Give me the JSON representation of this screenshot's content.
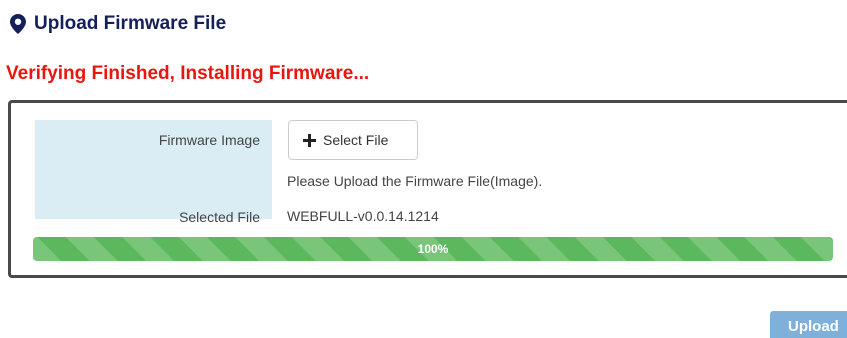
{
  "header": {
    "title": "Upload Firmware File",
    "icon": "map-marker-icon",
    "title_color": "#14205a"
  },
  "status": {
    "message": "Verifying Finished, Installing Firmware...",
    "color": "#e8160f"
  },
  "form": {
    "firmware_image_label": "Firmware Image",
    "select_file_button": "Select File",
    "select_file_icon": "plus-icon",
    "hint": "Please Upload the Firmware File(Image).",
    "selected_file_label": "Selected File",
    "selected_file_value": "WEBFULL-v0.0.14.1214",
    "label_bg": "#daedf5"
  },
  "progress": {
    "percent": 100,
    "label": "100%",
    "color": "#5cb85c"
  },
  "actions": {
    "upload_label": "Upload",
    "upload_color": "#7fb0d9"
  }
}
